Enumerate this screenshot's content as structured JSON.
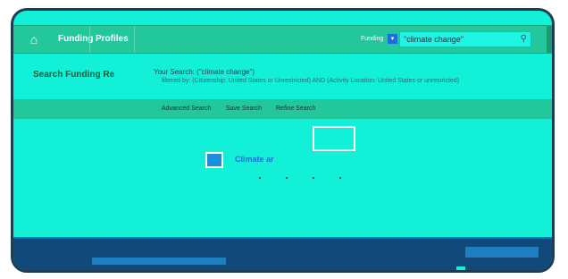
{
  "nav": {
    "home_icon": "home-icon",
    "funding_label": "Funding",
    "profiles_label": "Profiles",
    "scope_label": "Funding",
    "search_value": "\"climate change\""
  },
  "results": {
    "title": "Search Funding Re",
    "your_search": "Your Search: (\"climate change\")",
    "filter_line": "filtered by: (Citizenship: United States or Unrestricted) AND (Activity Location: United States or unrestricted)",
    "advanced_label": "Advanced Search",
    "save_label": "Save Search",
    "refine_label": "Refine Search",
    "result_text": "Climate ar"
  },
  "colors": {
    "accent": "#13f0d8",
    "nav_bg": "#22c79c",
    "frame": "#1f3d52",
    "footer": "#10497a"
  }
}
